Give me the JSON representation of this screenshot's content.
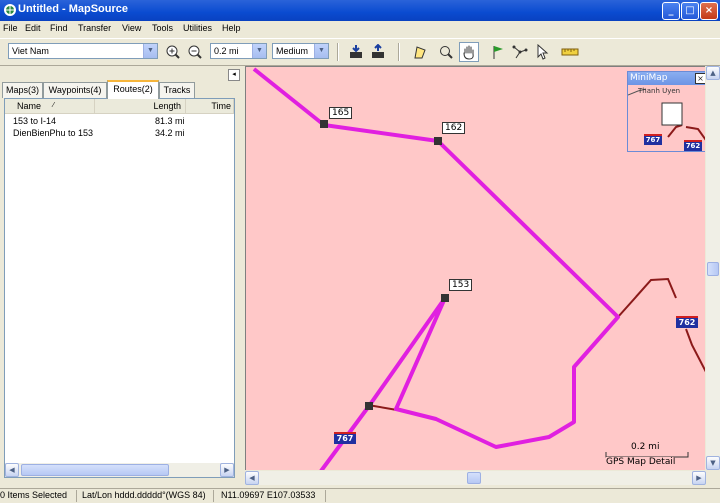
{
  "window": {
    "title": "Untitled - MapSource"
  },
  "menu": [
    "File",
    "Edit",
    "Find",
    "Transfer",
    "View",
    "Tools",
    "Utilities",
    "Help"
  ],
  "toolbar": {
    "map_product": "Viet Nam",
    "zoom_scale": "0.2 mi",
    "detail": "Medium"
  },
  "tabs": [
    {
      "label": "Maps(3)"
    },
    {
      "label": "Waypoints(4)"
    },
    {
      "label": "Routes(2)"
    },
    {
      "label": "Tracks"
    }
  ],
  "routes_table": {
    "columns": [
      "Name",
      "Length",
      "Time"
    ],
    "rows": [
      {
        "name": "153 to I-14",
        "length": "81.3 mi"
      },
      {
        "name": "DienBienPhu to 153",
        "length": "34.2 mi"
      }
    ]
  },
  "map": {
    "waypoints": [
      {
        "label": "165"
      },
      {
        "label": "162"
      },
      {
        "label": "153"
      }
    ],
    "road_shields": [
      "767",
      "762"
    ],
    "scale_label": "0.2 mi",
    "scale_caption": "GPS Map Detail",
    "minimap": {
      "title": "MiniMap",
      "place": "Thanh Uyen",
      "shields": [
        "767",
        "762"
      ]
    }
  },
  "status": {
    "selection": "0 Items Selected",
    "format": "Lat/Lon hddd.ddddd°(WGS 84)",
    "position": "N11.09697 E107.03533"
  },
  "colors": {
    "route": "#e020e0",
    "map_bg": "#ffc8c8",
    "road": "#8b1a1a"
  }
}
